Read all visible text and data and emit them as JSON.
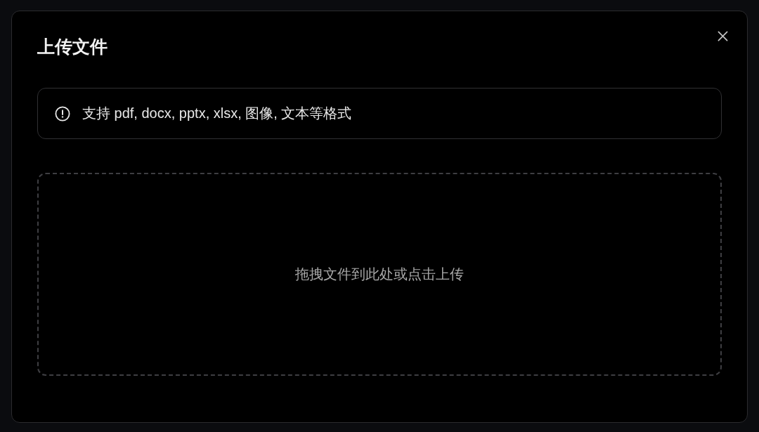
{
  "dialog": {
    "title": "上传文件"
  },
  "notice": {
    "text": "支持 pdf, docx, pptx, xlsx, 图像, 文本等格式"
  },
  "dropzone": {
    "text": "拖拽文件到此处或点击上传"
  }
}
